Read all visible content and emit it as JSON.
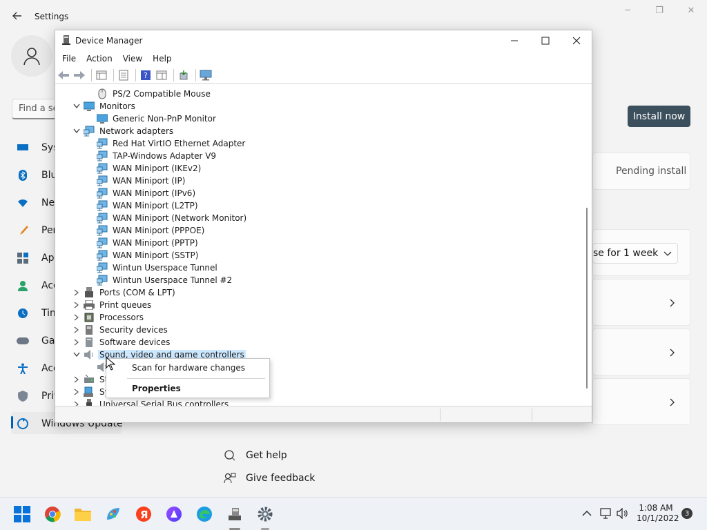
{
  "settings": {
    "title": "Settings",
    "search_text": "Find a se",
    "nav": [
      {
        "label": "Sys",
        "icon": "system-icon"
      },
      {
        "label": "Blu",
        "icon": "bluetooth-icon"
      },
      {
        "label": "Ne",
        "icon": "network-icon"
      },
      {
        "label": "Per",
        "icon": "personalization-icon"
      },
      {
        "label": "Ap",
        "icon": "apps-icon"
      },
      {
        "label": "Acc",
        "icon": "accounts-icon"
      },
      {
        "label": "Tim",
        "icon": "time-icon"
      },
      {
        "label": "Gar",
        "icon": "gaming-icon"
      },
      {
        "label": "Acc",
        "icon": "accessibility-icon"
      },
      {
        "label": "Priv",
        "icon": "privacy-icon"
      },
      {
        "label": "Windows Update",
        "icon": "windows-update-icon"
      }
    ],
    "install_button": "Install now",
    "pending_text": "Pending install",
    "pause_text": "se for 1 week",
    "get_help": "Get help",
    "give_feedback": "Give feedback"
  },
  "device_manager": {
    "title": "Device Manager",
    "menu": [
      "File",
      "Action",
      "View",
      "Help"
    ],
    "tree": [
      {
        "label": "PS/2 Compatible Mouse",
        "level": 1,
        "icon": "mouse-icon"
      },
      {
        "label": "Monitors",
        "level": 0,
        "expanded": true,
        "icon": "monitor-icon"
      },
      {
        "label": "Generic Non-PnP Monitor",
        "level": 1,
        "icon": "monitor-icon"
      },
      {
        "label": "Network adapters",
        "level": 0,
        "expanded": true,
        "icon": "network-adapter-icon"
      },
      {
        "label": "Red Hat VirtIO Ethernet Adapter",
        "level": 1,
        "icon": "network-adapter-icon"
      },
      {
        "label": "TAP-Windows Adapter V9",
        "level": 1,
        "icon": "network-adapter-icon"
      },
      {
        "label": "WAN Miniport (IKEv2)",
        "level": 1,
        "icon": "network-adapter-icon"
      },
      {
        "label": "WAN Miniport (IP)",
        "level": 1,
        "icon": "network-adapter-icon"
      },
      {
        "label": "WAN Miniport (IPv6)",
        "level": 1,
        "icon": "network-adapter-icon"
      },
      {
        "label": "WAN Miniport (L2TP)",
        "level": 1,
        "icon": "network-adapter-icon"
      },
      {
        "label": "WAN Miniport (Network Monitor)",
        "level": 1,
        "icon": "network-adapter-icon"
      },
      {
        "label": "WAN Miniport (PPPOE)",
        "level": 1,
        "icon": "network-adapter-icon"
      },
      {
        "label": "WAN Miniport (PPTP)",
        "level": 1,
        "icon": "network-adapter-icon"
      },
      {
        "label": "WAN Miniport (SSTP)",
        "level": 1,
        "icon": "network-adapter-icon"
      },
      {
        "label": "Wintun Userspace Tunnel",
        "level": 1,
        "icon": "network-adapter-icon"
      },
      {
        "label": "Wintun Userspace Tunnel #2",
        "level": 1,
        "icon": "network-adapter-icon"
      },
      {
        "label": "Ports (COM & LPT)",
        "level": 0,
        "expanded": false,
        "icon": "port-icon"
      },
      {
        "label": "Print queues",
        "level": 0,
        "expanded": false,
        "icon": "printer-icon"
      },
      {
        "label": "Processors",
        "level": 0,
        "expanded": false,
        "icon": "processor-icon"
      },
      {
        "label": "Security devices",
        "level": 0,
        "expanded": false,
        "icon": "security-device-icon"
      },
      {
        "label": "Software devices",
        "level": 0,
        "expanded": false,
        "icon": "software-device-icon"
      },
      {
        "label": "Sound, video and game controllers",
        "level": 0,
        "expanded": true,
        "selected": true,
        "icon": "speaker-icon"
      },
      {
        "label": "",
        "level": 1,
        "icon": "speaker-icon"
      },
      {
        "label": "St",
        "level": 0,
        "expanded": false,
        "icon": "storage-icon"
      },
      {
        "label": "Sy",
        "level": 0,
        "expanded": false,
        "icon": "system-devices-icon"
      },
      {
        "label": "Universal Serial Bus controllers",
        "level": 0,
        "expanded": false,
        "icon": "usb-icon"
      }
    ],
    "context_menu": {
      "scan": "Scan for hardware changes",
      "properties": "Properties"
    }
  },
  "taskbar": {
    "time": "1:08 AM",
    "date": "10/1/2022",
    "notifications": "3"
  }
}
